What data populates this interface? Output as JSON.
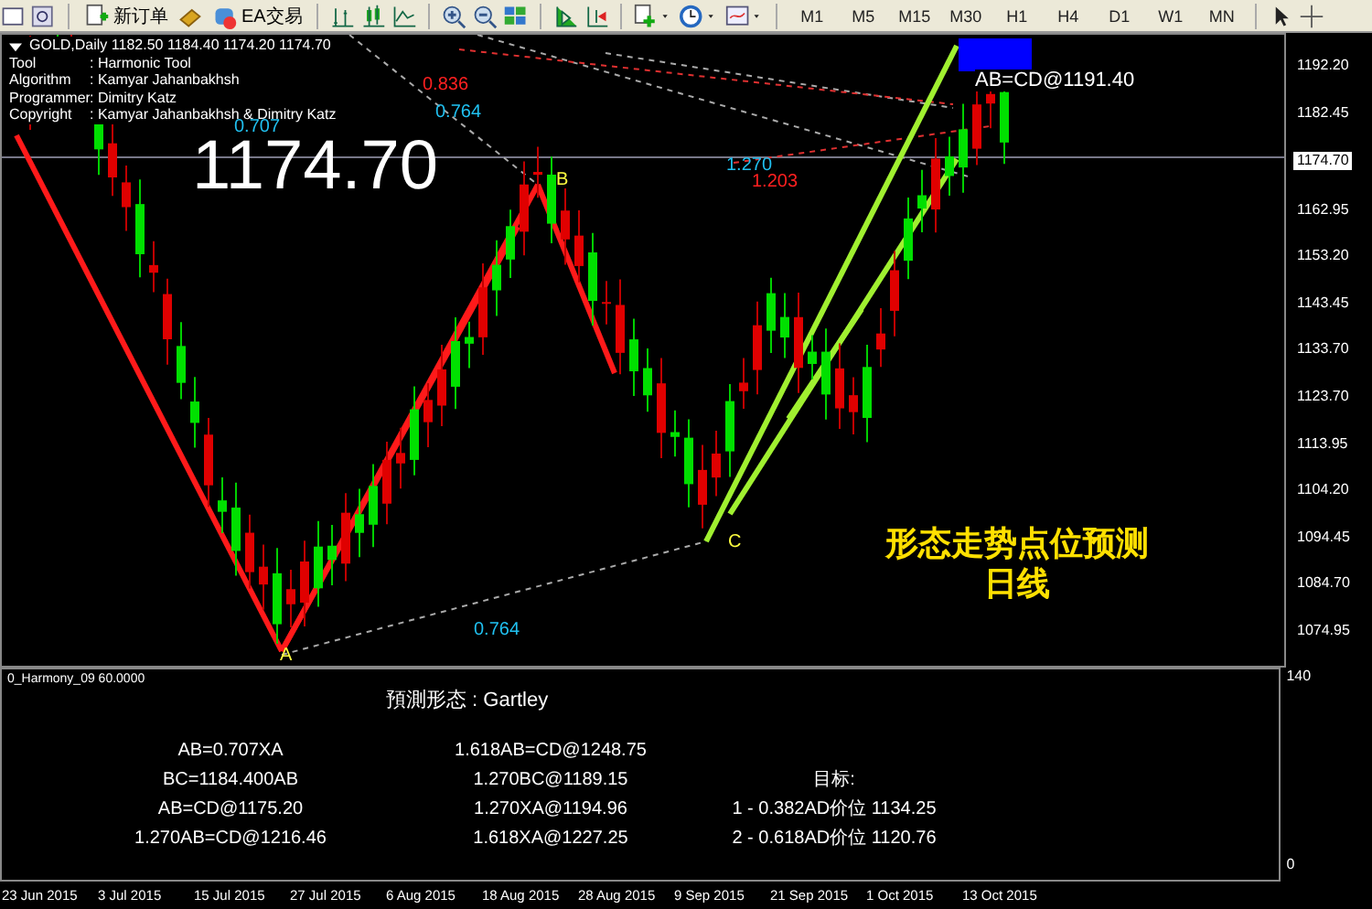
{
  "toolbar": {
    "order_button": "新订单",
    "ea_button": "EA交易",
    "timeframes": [
      {
        "label": "M1"
      },
      {
        "label": "M5"
      },
      {
        "label": "M15"
      },
      {
        "label": "M30"
      },
      {
        "label": "H1"
      },
      {
        "label": "H4"
      },
      {
        "label": "D1"
      },
      {
        "label": "W1"
      },
      {
        "label": "MN"
      }
    ]
  },
  "chart": {
    "symbol_line": "GOLD,Daily  1182.50 1184.40 1174.20 1174.70",
    "info": [
      {
        "label": "Tool",
        "value": ": Harmonic Tool"
      },
      {
        "label": "Algorithm",
        "value": ": Kamyar Jahanbakhsh"
      },
      {
        "label": "Programmer",
        "value": ": Dimitry Katz"
      },
      {
        "label": "Copyright",
        "value": ": Kamyar Jahanbakhsh & Dimitry Katz"
      }
    ],
    "big_price": "1174.70",
    "ratio_labels": [
      {
        "text": "0.836",
        "color": "#ff2020"
      },
      {
        "text": "0.764",
        "color": "#20c0f0"
      },
      {
        "text": "0.707",
        "color": "#20c0f0"
      },
      {
        "text": "1.270",
        "color": "#20c0f0"
      },
      {
        "text": "1.203",
        "color": "#ff2020"
      },
      {
        "text": "0.764",
        "color": "#20c0f0"
      }
    ],
    "point_labels": [
      "A",
      "B",
      "C"
    ],
    "projection_label": "AB=CD@1191.40",
    "annotation": [
      "形态走势点位预测",
      "日线"
    ]
  },
  "price_axis": {
    "ticks": [
      {
        "text": "1192.20",
        "kind": "tick"
      },
      {
        "text": "1182.45",
        "kind": "tick"
      },
      {
        "text": "1174.70",
        "kind": "current"
      },
      {
        "text": "1162.95",
        "kind": "tick"
      },
      {
        "text": "1153.20",
        "kind": "tick"
      },
      {
        "text": "1143.45",
        "kind": "tick"
      },
      {
        "text": "1133.70",
        "kind": "tick"
      },
      {
        "text": "1123.70",
        "kind": "tick"
      },
      {
        "text": "1113.95",
        "kind": "tick"
      },
      {
        "text": "1104.20",
        "kind": "tick"
      },
      {
        "text": "1094.45",
        "kind": "tick"
      },
      {
        "text": "1084.70",
        "kind": "tick"
      },
      {
        "text": "1074.95",
        "kind": "tick"
      }
    ]
  },
  "indicator": {
    "name": "0_Harmony_09 60.0000",
    "title": "預測形态 : Gartley",
    "column_1": [
      "AB=0.707XA",
      "BC=1184.400AB",
      "AB=CD@1175.20",
      "1.270AB=CD@1216.46"
    ],
    "column_2": [
      "1.618AB=CD@1248.75",
      "1.270BC@1189.15",
      "1.270XA@1194.96",
      "1.618XA@1227.25"
    ],
    "targets": [
      "目标:",
      "1 - 0.382AD价位 1134.25",
      "2 - 0.618AD价位 1120.76"
    ],
    "scale": [
      "140",
      "0"
    ]
  },
  "date_axis": [
    "23 Jun 2015",
    "3 Jul 2015",
    "15 Jul 2015",
    "27 Jul 2015",
    "6 Aug 2015",
    "18 Aug 2015",
    "28 Aug 2015",
    "9 Sep 2015",
    "21 Sep 2015",
    "1 Oct 2015",
    "13 Oct 2015"
  ]
}
